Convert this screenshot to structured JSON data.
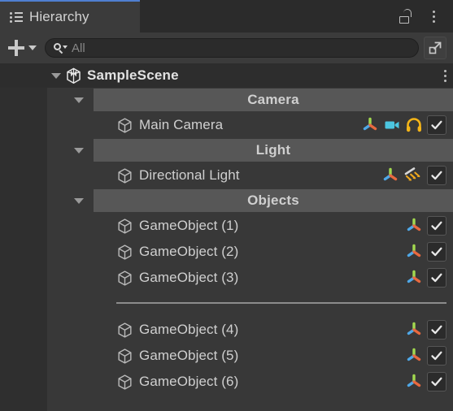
{
  "window": {
    "tab_label": "Hierarchy",
    "tab_icon": "hierarchy-list-icon",
    "lock_icon": "unlocked-padlock-icon",
    "menu_icon": "kebab-menu-icon",
    "accent_color": "#4f7fd1",
    "background_color": "#383838",
    "gutter_color": "#2f2f2f",
    "group_band_color": "#575757"
  },
  "toolbar": {
    "add_label": "+",
    "add_icon": "plus-icon",
    "add_dropdown_icon": "chevron-down-icon",
    "search_icon": "search-dropdown-icon",
    "search_value": "",
    "search_placeholder": "All",
    "expand_icon": "open-in-new-window-icon"
  },
  "tree": {
    "scene": {
      "name": "SampleScene",
      "icon": "unity-scene-icon",
      "expanded": true,
      "menu_icon": "kebab-menu-icon"
    },
    "rows": [
      {
        "kind": "group",
        "label": "Camera",
        "expanded": true
      },
      {
        "kind": "object",
        "label": "Main Camera",
        "icon": "cube-icon",
        "components": [
          "transform-gizmo-icon",
          "camera-icon",
          "audio-listener-icon"
        ],
        "enabled": true
      },
      {
        "kind": "group",
        "label": "Light",
        "expanded": true
      },
      {
        "kind": "object",
        "label": "Directional Light",
        "icon": "cube-icon",
        "components": [
          "transform-gizmo-icon",
          "directional-light-icon"
        ],
        "enabled": true
      },
      {
        "kind": "group",
        "label": "Objects",
        "expanded": true
      },
      {
        "kind": "object",
        "label": "GameObject (1)",
        "icon": "cube-icon",
        "components": [
          "transform-gizmo-icon"
        ],
        "enabled": true
      },
      {
        "kind": "object",
        "label": "GameObject (2)",
        "icon": "cube-icon",
        "components": [
          "transform-gizmo-icon"
        ],
        "enabled": true
      },
      {
        "kind": "object",
        "label": "GameObject (3)",
        "icon": "cube-icon",
        "components": [
          "transform-gizmo-icon"
        ],
        "enabled": true
      },
      {
        "kind": "separator"
      },
      {
        "kind": "object",
        "label": "GameObject (4)",
        "icon": "cube-icon",
        "components": [
          "transform-gizmo-icon"
        ],
        "enabled": true
      },
      {
        "kind": "object",
        "label": "GameObject (5)",
        "icon": "cube-icon",
        "components": [
          "transform-gizmo-icon"
        ],
        "enabled": true
      },
      {
        "kind": "object",
        "label": "GameObject (6)",
        "icon": "cube-icon",
        "components": [
          "transform-gizmo-icon"
        ],
        "enabled": true
      }
    ]
  }
}
